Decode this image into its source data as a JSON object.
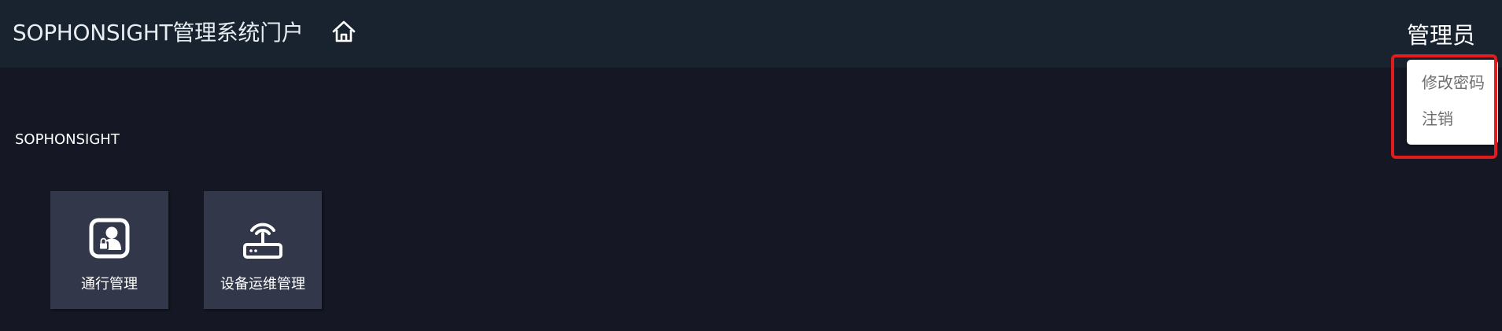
{
  "header": {
    "title": "SOPHONSIGHT管理系统门户",
    "home_icon": "home-icon",
    "user_label": "管理员"
  },
  "user_menu": {
    "items": [
      {
        "label": "修改密码"
      },
      {
        "label": "注销"
      }
    ],
    "highlight_color": "#e01c1c"
  },
  "section": {
    "label": "SOPHONSIGHT"
  },
  "tiles": [
    {
      "label": "通行管理",
      "icon": "access-control-icon"
    },
    {
      "label": "设备运维管理",
      "icon": "router-icon"
    }
  ],
  "colors": {
    "page_background": "#151824",
    "header_background": "#19232f",
    "tile_background": "#323849"
  }
}
